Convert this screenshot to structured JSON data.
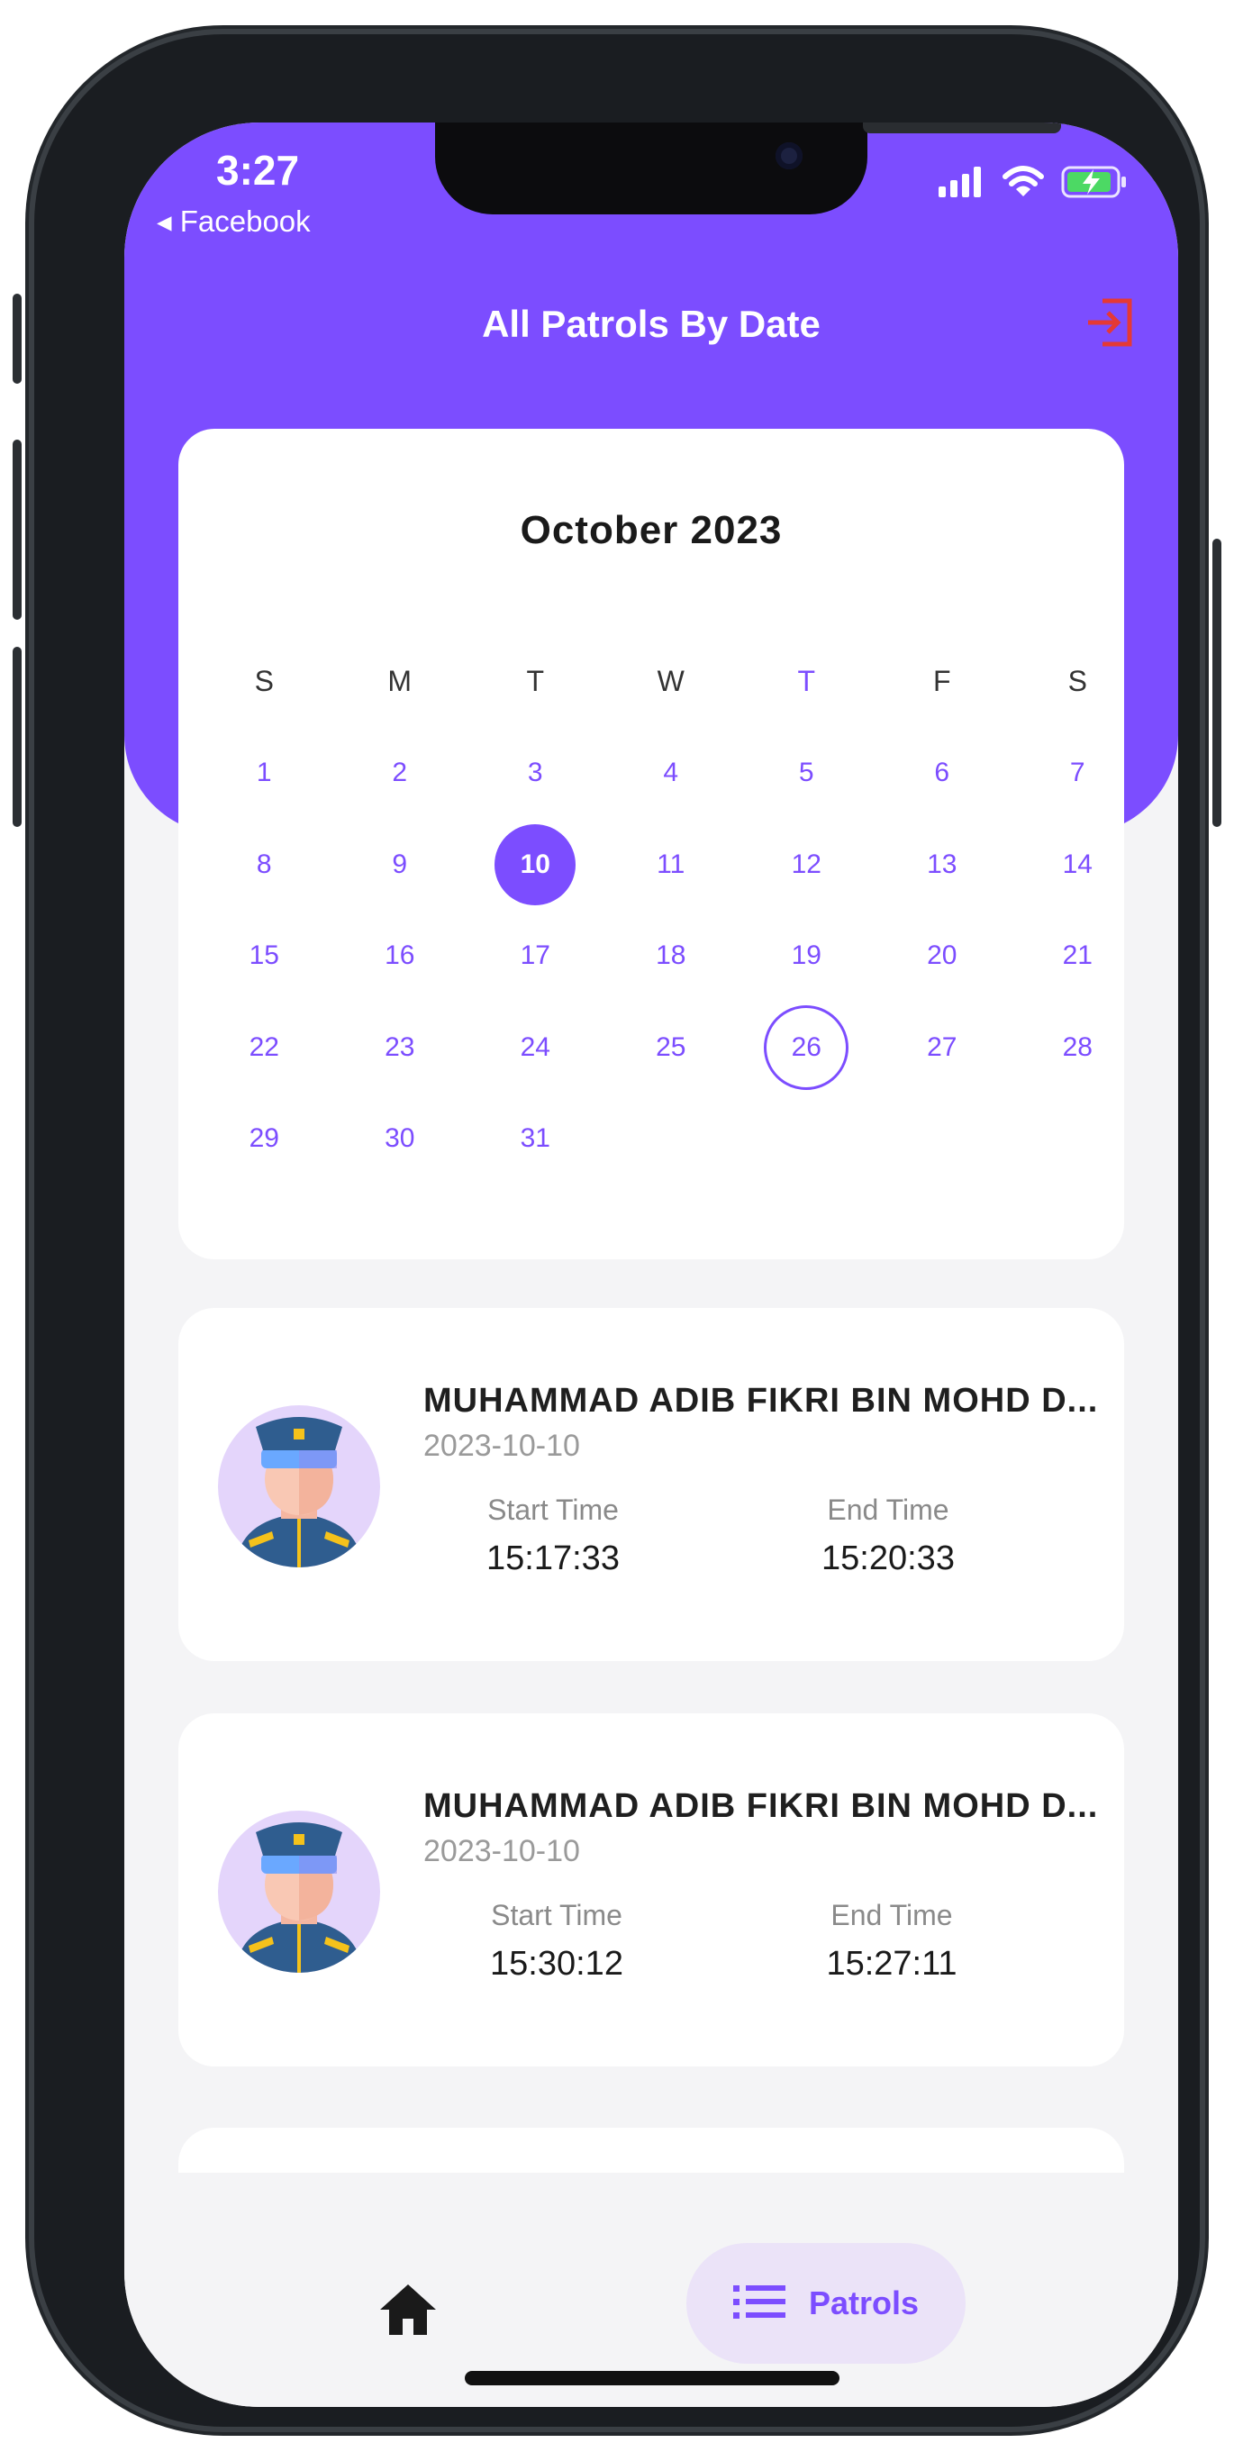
{
  "status_bar": {
    "time": "3:27",
    "back_app": "◂ Facebook",
    "icons": [
      "cellular-signal-icon",
      "wifi-icon",
      "battery-charging-icon"
    ]
  },
  "header": {
    "title": "All Patrols By Date",
    "logout_icon": "logout-icon"
  },
  "colors": {
    "primary": "#7c4dff",
    "logout": "#e53935",
    "background": "#f4f4f6",
    "card": "#ffffff"
  },
  "calendar": {
    "month_label": "October 2023",
    "weekdays": [
      "S",
      "M",
      "T",
      "W",
      "T",
      "F",
      "S"
    ],
    "days": [
      "1",
      "2",
      "3",
      "4",
      "5",
      "6",
      "7",
      "8",
      "9",
      "10",
      "11",
      "12",
      "13",
      "14",
      "15",
      "16",
      "17",
      "18",
      "19",
      "20",
      "21",
      "22",
      "23",
      "24",
      "25",
      "26",
      "27",
      "28",
      "29",
      "30",
      "31"
    ],
    "selected_day": "10",
    "today_day": "26"
  },
  "patrols": [
    {
      "name": "MUHAMMAD ADIB FIKRI BIN MOHD D...",
      "date": "2023-10-10",
      "start_label": "Start Time",
      "start_time": "15:17:33",
      "end_label": "End Time",
      "end_time": "15:20:33"
    },
    {
      "name": "MUHAMMAD ADIB FIKRI BIN MOHD D...",
      "date": "2023-10-10",
      "start_label": "Start Time",
      "start_time": "15:30:12",
      "end_label": "End Time",
      "end_time": "15:27:11"
    }
  ],
  "bottom_nav": {
    "home_icon": "home-icon",
    "patrols_icon": "list-icon",
    "patrols_label": "Patrols"
  }
}
